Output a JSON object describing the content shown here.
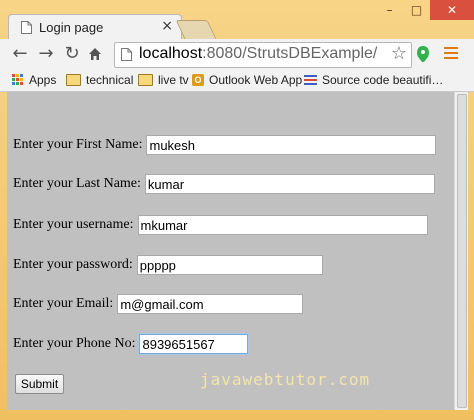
{
  "browser": {
    "tab": {
      "title": "Login page",
      "close": "×"
    },
    "window_controls": {
      "minimize": "–",
      "maximize": "□",
      "close": "✕"
    },
    "address": {
      "host": "localhost",
      "rest": ":8080/StrutsDBExample/"
    },
    "bookmarks": [
      {
        "label": "Apps",
        "icon": "apps-grid-icon"
      },
      {
        "label": "technical",
        "icon": "folder-icon"
      },
      {
        "label": "live tv",
        "icon": "folder-icon"
      },
      {
        "label": "Outlook Web App",
        "icon": "outlook-icon"
      },
      {
        "label": "Source code beautifi…",
        "icon": "source-code-icon"
      }
    ],
    "colors": {
      "frame": "#f3c86f",
      "menu_accent": "#e07a12",
      "page_bg": "#c0c0c0"
    }
  },
  "form": {
    "first_name": {
      "label": "Enter your First Name:",
      "value": "mukesh"
    },
    "last_name": {
      "label": "Enter your Last Name:",
      "value": "kumar"
    },
    "username": {
      "label": "Enter your username:",
      "value": "mkumar"
    },
    "password": {
      "label": "Enter your password:",
      "value": "ppppp"
    },
    "email": {
      "label": "Enter your Email:",
      "value": "m@gmail.com"
    },
    "phone": {
      "label": "Enter your Phone No:",
      "value": "8939651567"
    },
    "submit_label": "Submit"
  },
  "watermark": "javawebtutor.com"
}
